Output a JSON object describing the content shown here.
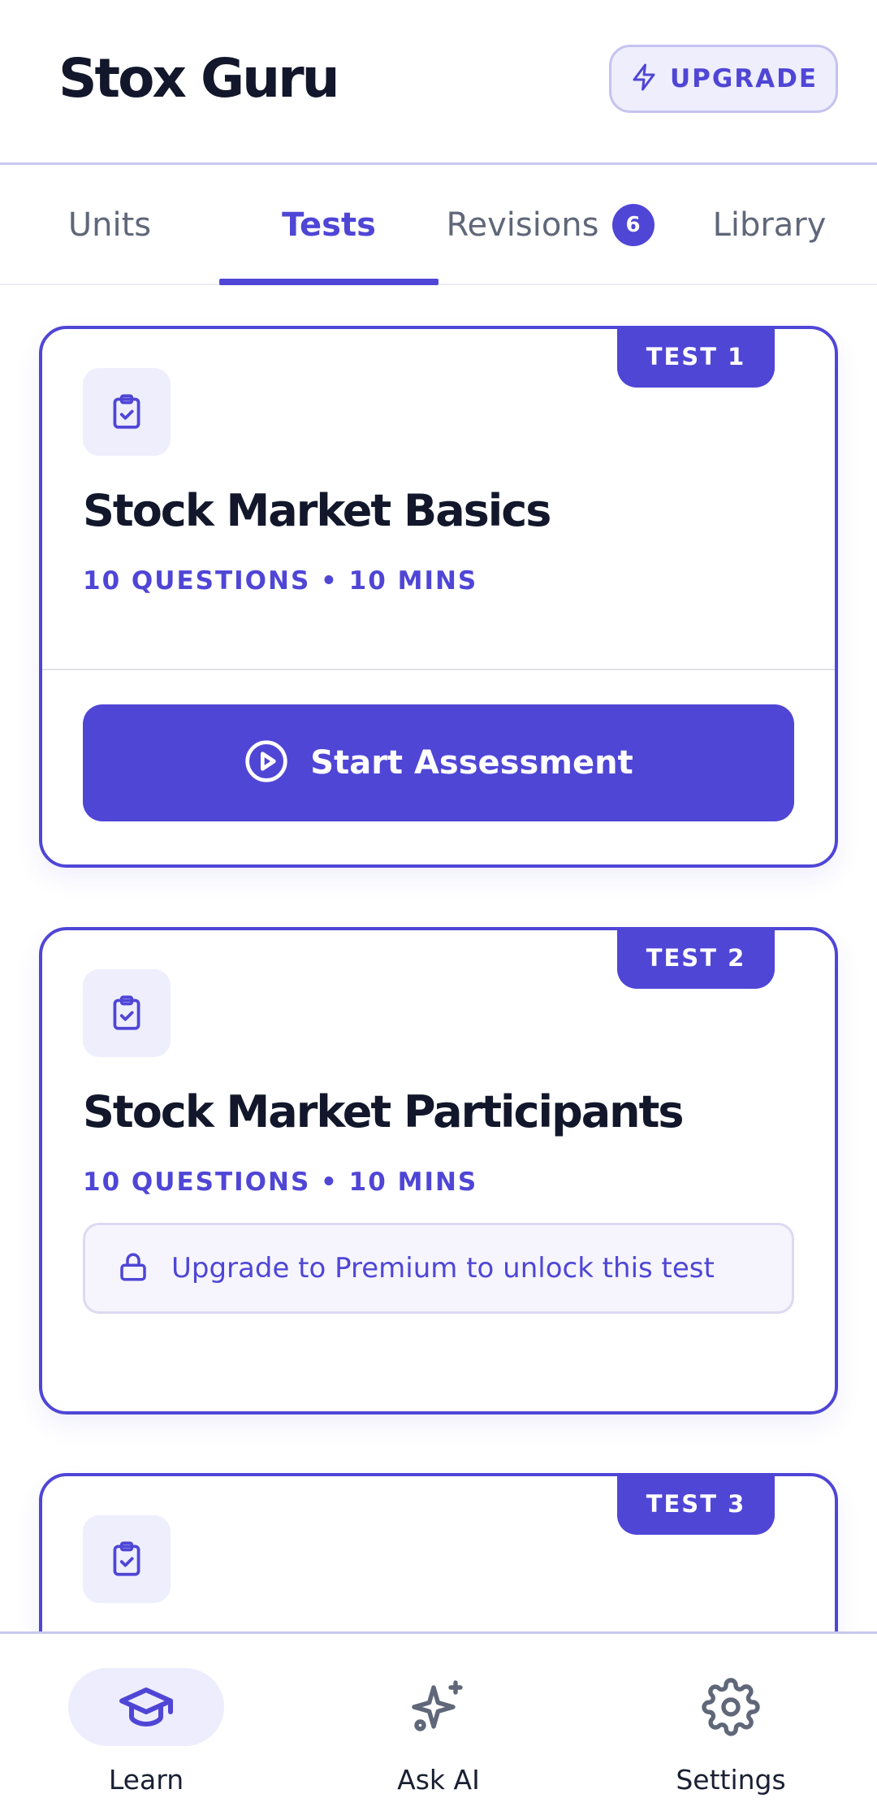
{
  "header": {
    "app_title": "Stox Guru",
    "upgrade_label": "UPGRADE"
  },
  "tabs": [
    {
      "label": "Units",
      "active": false
    },
    {
      "label": "Tests",
      "active": true
    },
    {
      "label": "Revisions",
      "active": false,
      "badge": "6"
    },
    {
      "label": "Library",
      "active": false
    }
  ],
  "cards": [
    {
      "tag": "TEST 1",
      "icon": "clipboard-check-icon",
      "title": "Stock Market Basics",
      "meta": "10 QUESTIONS  •  10 MINS",
      "action_label": "Start Assessment",
      "locked": false
    },
    {
      "tag": "TEST 2",
      "icon": "clipboard-check-icon",
      "title": "Stock Market Participants",
      "meta": "10 QUESTIONS  •  10 MINS",
      "lock_message": "Upgrade to Premium to unlock this test",
      "locked": true
    },
    {
      "tag": "TEST 3",
      "icon": "clipboard-check-icon"
    }
  ],
  "bottom_nav": [
    {
      "label": "Learn",
      "icon": "graduation-cap-icon",
      "active": true
    },
    {
      "label": "Ask AI",
      "icon": "sparkles-icon",
      "active": false
    },
    {
      "label": "Settings",
      "icon": "gear-icon",
      "active": false
    }
  ],
  "colors": {
    "accent": "#4f46d6",
    "accent_light": "#eeedfd",
    "text_dark": "#12172b",
    "text_muted": "#5f6779"
  }
}
